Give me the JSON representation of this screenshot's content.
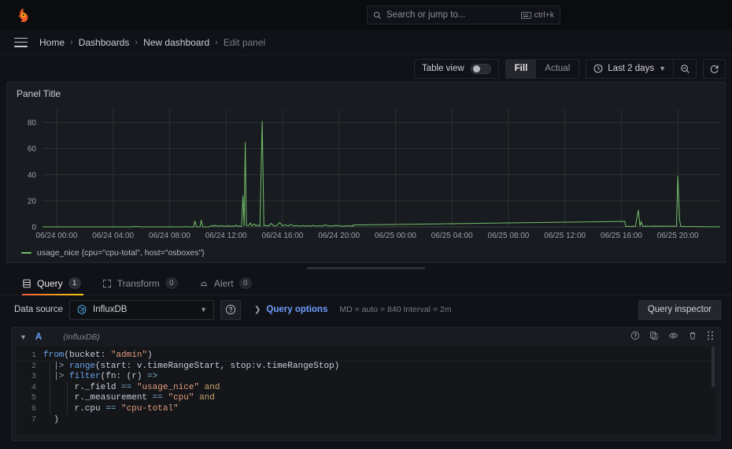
{
  "topnav": {
    "logo_name": "grafana-logo",
    "search": {
      "placeholder": "Search or jump to...",
      "shortcut": "ctrl+k"
    }
  },
  "breadcrumb": {
    "items": [
      {
        "label": "Home",
        "current": false
      },
      {
        "label": "Dashboards",
        "current": false
      },
      {
        "label": "New dashboard",
        "current": false
      },
      {
        "label": "Edit panel",
        "current": true
      }
    ],
    "separator": "›"
  },
  "toolbar": {
    "table_view_label": "Table view",
    "table_view_on": false,
    "fill_label": "Fill",
    "actual_label": "Actual",
    "time_range_label": "Last 2 days",
    "zoom_out_icon": "zoom-out-icon",
    "refresh_icon": "refresh-icon"
  },
  "panel": {
    "title": "Panel Title",
    "legend": {
      "label": "usage_nice {cpu=\"cpu-total\", host=\"osboxes\"}",
      "color": "#73bf69"
    }
  },
  "chart_data": {
    "type": "line",
    "title": "Panel Title",
    "xlabel": "",
    "ylabel": "",
    "ylim": [
      0,
      90
    ],
    "yticks": [
      0,
      20,
      40,
      60,
      80
    ],
    "xticks": [
      "06/24 00:00",
      "06/24 04:00",
      "06/24 08:00",
      "06/24 12:00",
      "06/24 16:00",
      "06/24 20:00",
      "06/25 00:00",
      "06/25 04:00",
      "06/25 08:00",
      "06/25 12:00",
      "06/25 16:00",
      "06/25 20:00"
    ],
    "grid": true,
    "legend_position": "bottom-left",
    "series": [
      {
        "name": "usage_nice {cpu=\"cpu-total\", host=\"osboxes\"}",
        "color": "#73bf69",
        "points": [
          [
            0,
            0
          ],
          [
            3.2,
            0
          ],
          [
            3.3,
            0.4
          ],
          [
            3.45,
            0
          ],
          [
            3.6,
            0
          ],
          [
            5.0,
            0
          ],
          [
            5.05,
            0.3
          ],
          [
            5.1,
            0
          ],
          [
            5.35,
            0
          ],
          [
            5.4,
            4.6
          ],
          [
            5.45,
            0
          ],
          [
            5.58,
            0
          ],
          [
            5.62,
            5.2
          ],
          [
            5.68,
            0
          ],
          [
            5.9,
            0
          ],
          [
            6.0,
            1.0
          ],
          [
            6.05,
            0.4
          ],
          [
            6.1,
            1.3
          ],
          [
            6.15,
            0.5
          ],
          [
            6.2,
            0.9
          ],
          [
            6.28,
            0.4
          ],
          [
            6.32,
            1.1
          ],
          [
            6.4,
            0.5
          ],
          [
            6.5,
            0.6
          ],
          [
            6.55,
            0.3
          ],
          [
            6.6,
            1.2
          ],
          [
            6.65,
            0.4
          ],
          [
            6.72,
            0.8
          ],
          [
            6.78,
            0.3
          ],
          [
            6.85,
            1.4
          ],
          [
            6.9,
            0.4
          ],
          [
            6.95,
            0.9
          ],
          [
            7.0,
            0.3
          ],
          [
            7.05,
            0.5
          ],
          [
            7.1,
            24.0
          ],
          [
            7.14,
            0.7
          ],
          [
            7.18,
            65.0
          ],
          [
            7.22,
            1.2
          ],
          [
            7.3,
            0.9
          ],
          [
            7.36,
            3.0
          ],
          [
            7.42,
            0.8
          ],
          [
            7.5,
            2.2
          ],
          [
            7.56,
            0.7
          ],
          [
            7.62,
            1.5
          ],
          [
            7.7,
            0.6
          ],
          [
            7.78,
            81.0
          ],
          [
            7.84,
            0.8
          ],
          [
            7.92,
            1.2
          ],
          [
            8.0,
            0.6
          ],
          [
            8.1,
            2.6
          ],
          [
            8.2,
            0.7
          ],
          [
            8.3,
            1.0
          ],
          [
            8.4,
            3.4
          ],
          [
            8.5,
            0.8
          ],
          [
            8.6,
            1.6
          ],
          [
            8.7,
            0.7
          ],
          [
            8.8,
            2.0
          ],
          [
            8.9,
            0.6
          ],
          [
            9.0,
            1.1
          ],
          [
            9.1,
            0.5
          ],
          [
            9.2,
            1.0
          ],
          [
            9.3,
            0.6
          ],
          [
            9.4,
            0.9
          ],
          [
            9.5,
            0.5
          ],
          [
            9.6,
            1.2
          ],
          [
            9.7,
            0.5
          ],
          [
            9.8,
            0.8
          ],
          [
            9.9,
            0.5
          ],
          [
            10.0,
            1.5
          ],
          [
            10.2,
            0.5
          ],
          [
            10.4,
            1.1
          ],
          [
            10.6,
            0.5
          ],
          [
            10.8,
            0.8
          ],
          [
            11.0,
            0.5
          ],
          [
            11.0,
            1.4
          ],
          [
            20.6,
            4.2
          ],
          [
            20.62,
            4.2
          ],
          [
            20.66,
            0.3
          ],
          [
            20.8,
            0.4
          ],
          [
            20.9,
            0.5
          ],
          [
            21.0,
            0.4
          ],
          [
            21.1,
            13.0
          ],
          [
            21.16,
            0.5
          ],
          [
            21.2,
            4.0
          ],
          [
            21.26,
            0.4
          ],
          [
            21.4,
            0.6
          ],
          [
            21.5,
            0.4
          ],
          [
            21.6,
            0.6
          ],
          [
            21.8,
            0.5
          ],
          [
            22.0,
            0.6
          ],
          [
            22.2,
            0.5
          ],
          [
            22.45,
            0.5
          ],
          [
            22.5,
            39.0
          ],
          [
            22.56,
            6.0
          ],
          [
            22.6,
            0.5
          ],
          [
            22.8,
            0.3
          ],
          [
            23.2,
            0.2
          ],
          [
            23.6,
            0.1
          ],
          [
            24.0,
            0.1
          ]
        ]
      }
    ]
  },
  "tabs": [
    {
      "label": "Query",
      "badge": "1",
      "icon": "database-icon",
      "active": true
    },
    {
      "label": "Transform",
      "badge": "0",
      "icon": "transform-icon",
      "active": false
    },
    {
      "label": "Alert",
      "badge": "0",
      "icon": "bell-icon",
      "active": false
    }
  ],
  "datasource_row": {
    "label": "Data source",
    "selected": "InfluxDB",
    "datasource_icon": "influxdb-icon",
    "help_icon": "help-circle-icon",
    "query_options_label": "Query options",
    "query_options_meta": "MD = auto = 840    Interval = 2m",
    "query_inspector_label": "Query inspector"
  },
  "query_row": {
    "ref_id": "A",
    "datasource_note": "(InfluxDB)",
    "actions": [
      {
        "name": "help-circle-icon"
      },
      {
        "name": "duplicate-icon"
      },
      {
        "name": "eye-icon"
      },
      {
        "name": "trash-icon"
      },
      {
        "name": "drag-handle-icon"
      }
    ],
    "code_lines": [
      {
        "n": "1",
        "text": "from(bucket: \"admin\")"
      },
      {
        "n": "2",
        "text": "  |> range(start: v.timeRangeStart, stop:v.timeRangeStop)"
      },
      {
        "n": "3",
        "text": "  |> filter(fn: (r) =>"
      },
      {
        "n": "4",
        "text": "      r._field == \"usage_nice\" and"
      },
      {
        "n": "5",
        "text": "      r._measurement == \"cpu\" and"
      },
      {
        "n": "6",
        "text": "      r.cpu == \"cpu-total\""
      },
      {
        "n": "7",
        "text": "  )"
      }
    ]
  }
}
